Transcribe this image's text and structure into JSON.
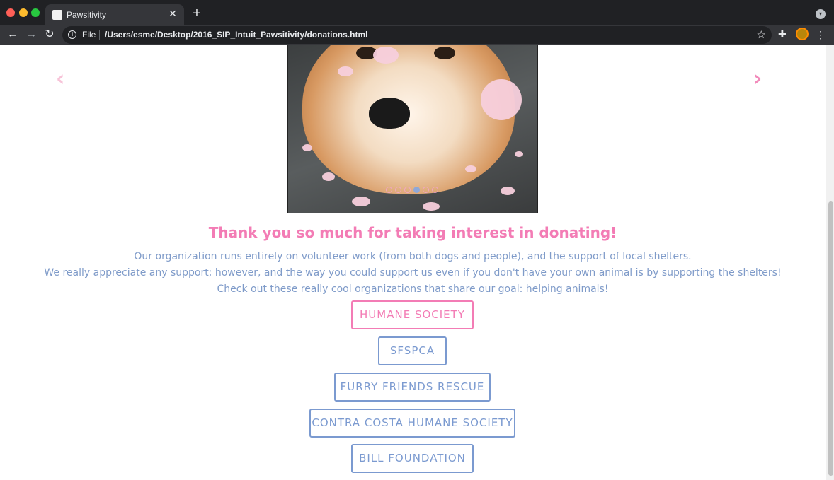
{
  "browser": {
    "tab_title": "Pawsitivity",
    "tab_close": "✕",
    "new_tab": "+",
    "scheme_label": "File",
    "url": "/Users/esme/Desktop/2016_SIP_Intuit_Pawsitivity/donations.html"
  },
  "carousel": {
    "prev_arrow": "‹",
    "next_arrow": "›",
    "indicator_count": 6,
    "active_indicator": 3
  },
  "content": {
    "heading": "Thank you so much for taking interest in donating!",
    "paragraph_lines": [
      "Our organization runs entirely on volunteer work (from both dogs and people), and the support of local shelters.",
      "We really appreciate any support; however, and the way you could support us even if you don't have your own animal is by supporting the shelters!",
      "Check out these really cool organizations that share our goal: helping animals!"
    ]
  },
  "organizations": [
    {
      "label": "HUMANE SOCIETY"
    },
    {
      "label": "SFSPCA"
    },
    {
      "label": "FURRY FRIENDS RESCUE"
    },
    {
      "label": "CONTRA COSTA HUMANE SOCIETY"
    },
    {
      "label": "BILL FOUNDATION"
    }
  ],
  "colors": {
    "accent_pink": "#f37cb5",
    "accent_blue": "#7b9ad0",
    "text_blue": "#7f9bc9"
  }
}
